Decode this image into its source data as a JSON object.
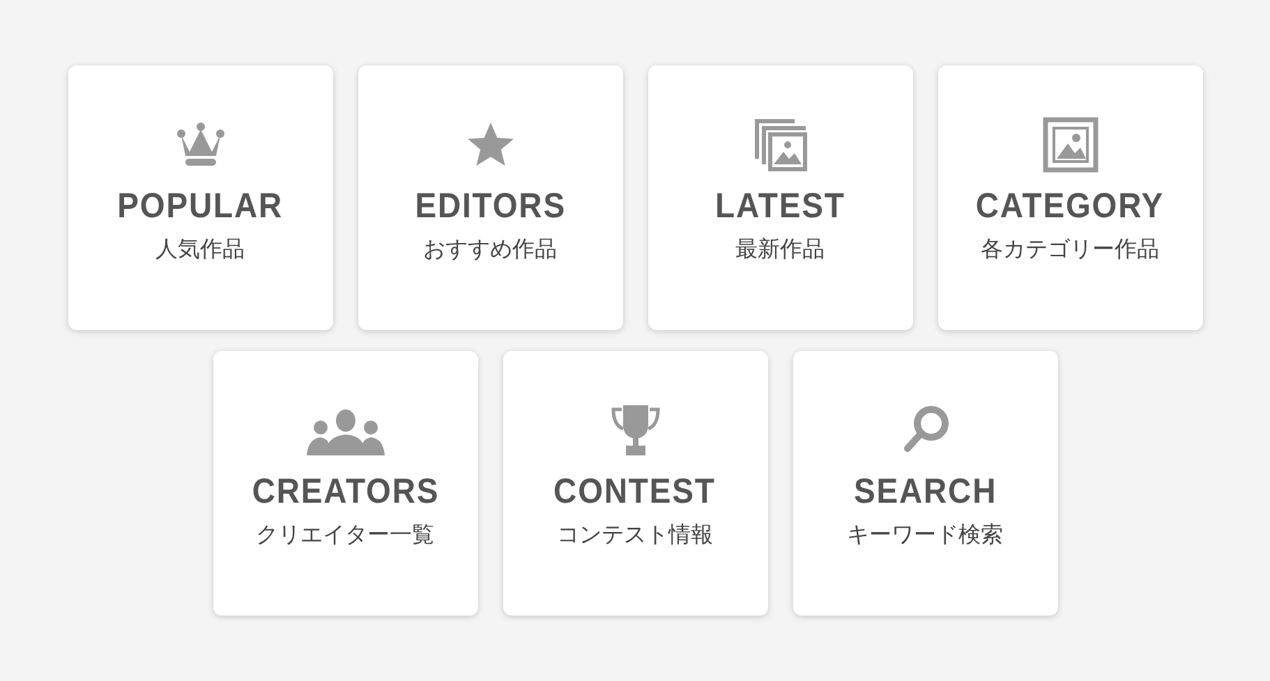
{
  "rows": [
    {
      "tiles": [
        {
          "kind": "crown",
          "title": "POPULAR",
          "subtitle": "人気作品"
        },
        {
          "kind": "star",
          "title": "EDITORS",
          "subtitle": "おすすめ作品"
        },
        {
          "kind": "images",
          "title": "LATEST",
          "subtitle": "最新作品"
        },
        {
          "kind": "image",
          "title": "CATEGORY",
          "subtitle": "各カテゴリー作品"
        }
      ]
    },
    {
      "tiles": [
        {
          "kind": "people",
          "title": "CREATORS",
          "subtitle": "クリエイター一覧"
        },
        {
          "kind": "trophy",
          "title": "CONTEST",
          "subtitle": "コンテスト情報"
        },
        {
          "kind": "search",
          "title": "SEARCH",
          "subtitle": "キーワード検索"
        }
      ]
    }
  ]
}
